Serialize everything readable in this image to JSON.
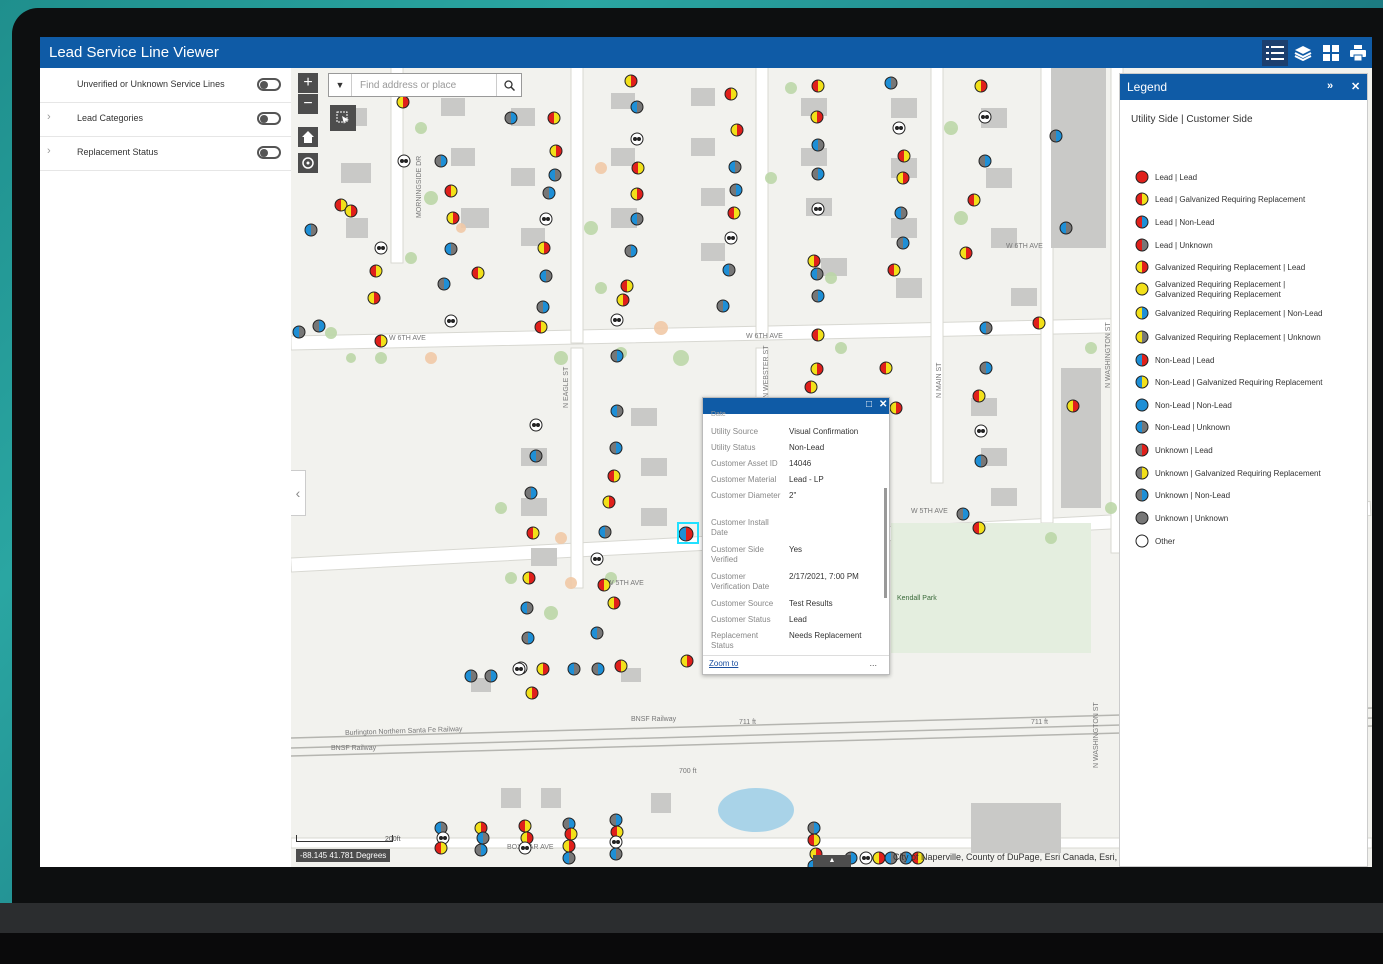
{
  "app": {
    "title": "Lead Service Line Viewer"
  },
  "toolbar": {
    "icons": [
      "legend-icon",
      "layers-icon",
      "basemap-icon",
      "print-icon"
    ]
  },
  "layers_panel": {
    "items": [
      {
        "label": "Unverified or Unknown Service Lines",
        "expandable": false
      },
      {
        "label": "Lead Categories",
        "expandable": true
      },
      {
        "label": "Replacement Status",
        "expandable": true
      }
    ]
  },
  "search": {
    "placeholder": "Find address or place"
  },
  "legend": {
    "title": "Legend",
    "subtitle": "Utility Side | Customer Side",
    "items": [
      {
        "label": "Lead | Lead",
        "left": "#e0201b",
        "right": "#e0201b"
      },
      {
        "label": "Lead | Galvanized Requiring Replacement",
        "left": "#e0201b",
        "right": "#f2e01a"
      },
      {
        "label": "Lead | Non-Lead",
        "left": "#e0201b",
        "right": "#1e8fd6"
      },
      {
        "label": "Lead | Unknown",
        "left": "#e0201b",
        "right": "#777777"
      },
      {
        "label": "Galvanized Requiring Replacement | Lead",
        "left": "#f2e01a",
        "right": "#e0201b"
      },
      {
        "label": "Galvanized Requiring Replacement | Galvanized Requiring Replacement",
        "left": "#f2e01a",
        "right": "#f2e01a"
      },
      {
        "label": "Galvanized Requiring Replacement | Non-Lead",
        "left": "#f2e01a",
        "right": "#1e8fd6"
      },
      {
        "label": "Galvanized Requiring Replacement | Unknown",
        "left": "#f2e01a",
        "right": "#777777"
      },
      {
        "label": "Non-Lead | Lead",
        "left": "#1e8fd6",
        "right": "#e0201b"
      },
      {
        "label": "Non-Lead | Galvanized Requiring Replacement",
        "left": "#1e8fd6",
        "right": "#f2e01a"
      },
      {
        "label": "Non-Lead | Non-Lead",
        "left": "#1e8fd6",
        "right": "#1e8fd6"
      },
      {
        "label": "Non-Lead | Unknown",
        "left": "#1e8fd6",
        "right": "#777777"
      },
      {
        "label": "Unknown | Lead",
        "left": "#777777",
        "right": "#e0201b"
      },
      {
        "label": "Unknown | Galvanized Requiring Replacement",
        "left": "#777777",
        "right": "#f2e01a"
      },
      {
        "label": "Unknown | Non-Lead",
        "left": "#777777",
        "right": "#1e8fd6"
      },
      {
        "label": "Unknown | Unknown",
        "left": "#777777",
        "right": "#777777"
      },
      {
        "label": "Other",
        "left": "#ffffff",
        "right": "#ffffff"
      }
    ]
  },
  "popup": {
    "partial_top": "Date",
    "rows": [
      {
        "key": "Utility Source",
        "value": "Visual Confirmation"
      },
      {
        "key": "Utility Status",
        "value": "Non-Lead"
      },
      {
        "key": "Customer Asset ID",
        "value": "14046"
      },
      {
        "key": "Customer Material",
        "value": "Lead - LP"
      },
      {
        "key": "Customer Diameter",
        "value": "2\""
      },
      {
        "key": "Customer Install Date",
        "value": ""
      },
      {
        "key": "Customer Side Verified",
        "value": "Yes"
      },
      {
        "key": "Customer Verification Date",
        "value": "2/17/2021, 7:00 PM"
      },
      {
        "key": "Customer Source",
        "value": "Test Results"
      },
      {
        "key": "Customer Status",
        "value": "Lead"
      },
      {
        "key": "Replacement Status",
        "value": "Needs Replacement"
      }
    ],
    "zoom_to": "Zoom to",
    "more": "..."
  },
  "map": {
    "streets": [
      "W 6TH AVE",
      "W 6TH AVE",
      "W 6TH AVE",
      "W 5TH AVE",
      "W 5TH AVE",
      "BOX CAR AVE",
      "N EAGLE ST",
      "N WEBSTER ST",
      "N MAIN ST",
      "N WASHINGTON ST",
      "N WASHINGTON ST",
      "MORNINGSIDE DR",
      "Kendall Park",
      "Burlington Northern Santa Fe Railway",
      "BNSF Railway",
      "BNSF Railway",
      "711 ft",
      "711 ft",
      "700 ft"
    ],
    "scale": "200ft",
    "coordinates": "-88.145 41.781 Degrees",
    "attribution": "City of Naperville, County of DuPage, Esri Canada, Esri,"
  },
  "colors": {
    "brand": "#0f5ba6",
    "lead": "#e0201b",
    "galvanized": "#f2e01a",
    "non_lead": "#1e8fd6",
    "unknown": "#777777"
  }
}
